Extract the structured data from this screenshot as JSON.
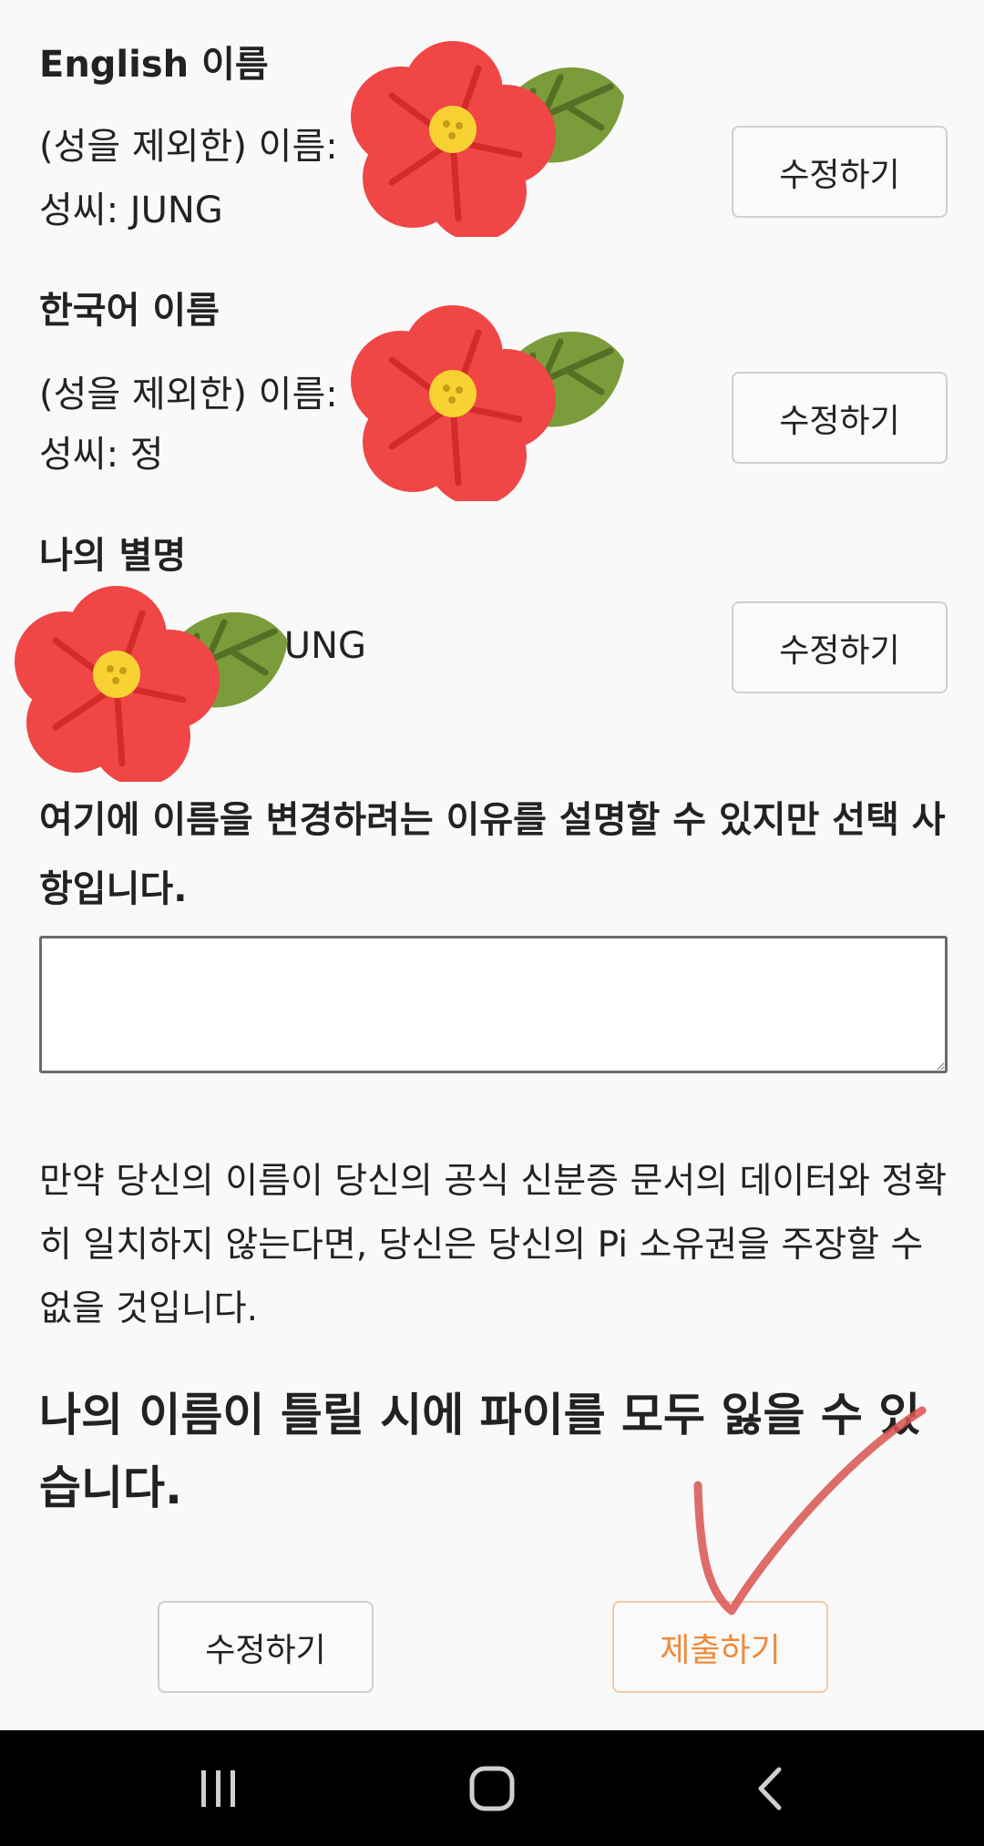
{
  "english_name": {
    "title": "English 이름",
    "given_name_label": "(성을 제외한) 이름:",
    "surname_line": "성씨: JUNG",
    "edit_label": "수정하기"
  },
  "korean_name": {
    "title": "한국어 이름",
    "given_name_label": "(성을 제외한) 이름:",
    "surname_line": "성씨: 정",
    "edit_label": "수정하기"
  },
  "nickname": {
    "title": "나의 별명",
    "visible_value": "JUNG",
    "edit_label": "수정하기"
  },
  "reason": {
    "label": "여기에 이름을 변경하려는 이유를 설명할 수 있지만 선택 사항입니다.",
    "value": ""
  },
  "notice": {
    "text": "만약 당신의 이름이 당신의 공식 신분증 문서의 데이터와 정확히 일치하지 않는다면, 당신은 당신의 Pi 소유권을 주장할 수 없을 것입니다.",
    "warning": "나의 이름이 틀릴 시에 파이를 모두 잃을 수 있습니다."
  },
  "actions": {
    "edit_label": "수정하기",
    "submit_label": "제출하기",
    "submit_color": "#ef8a3a"
  },
  "nav": {
    "recents_icon": "recents-icon",
    "home_icon": "home-icon",
    "back_icon": "back-icon"
  }
}
